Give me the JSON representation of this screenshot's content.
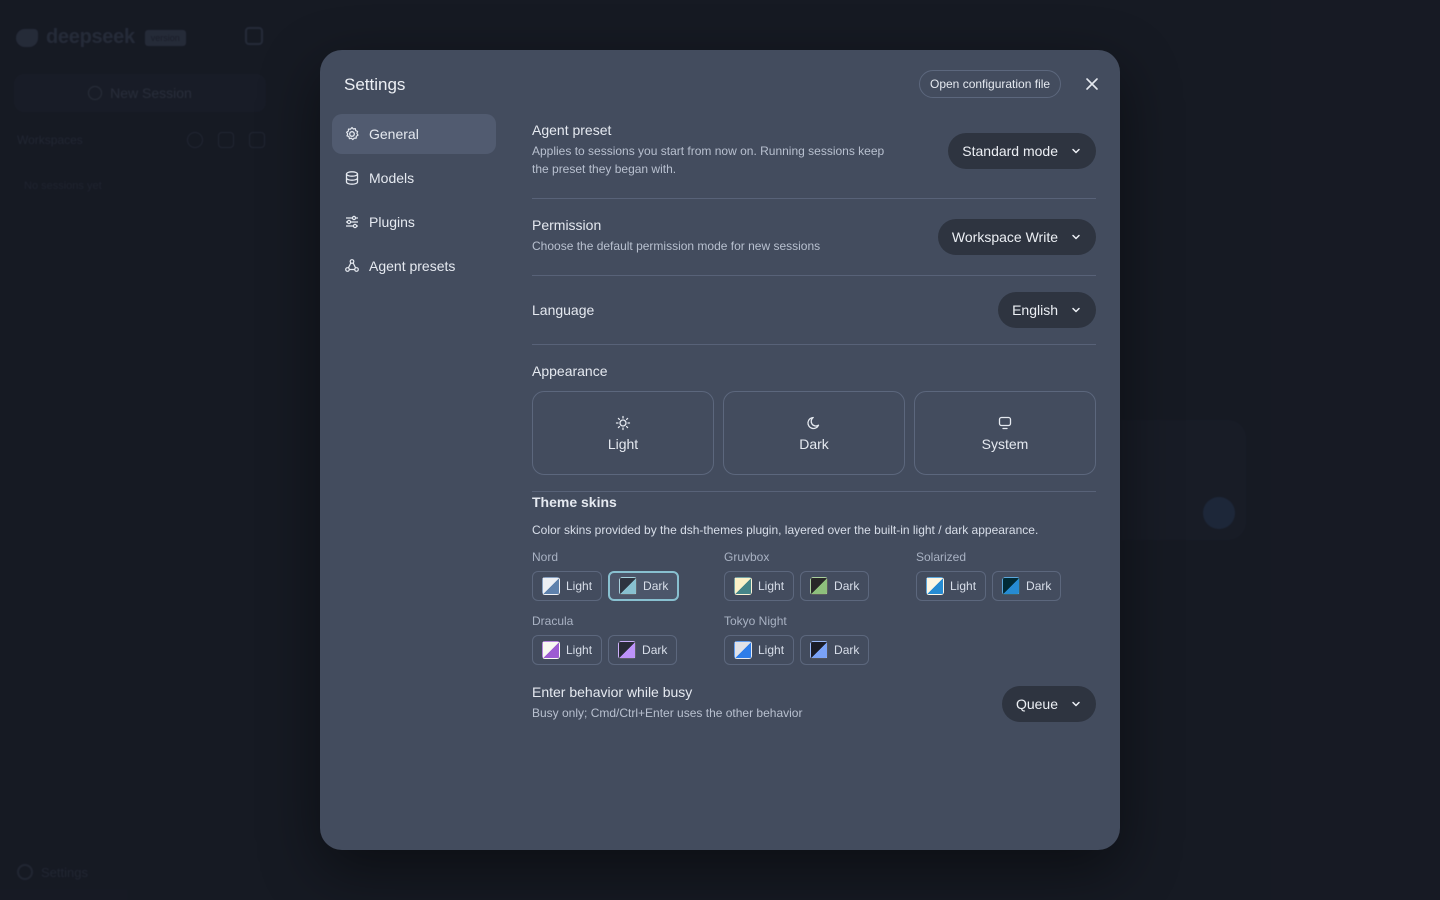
{
  "background_app": {
    "brand": "deepseek",
    "brand_badge": "version",
    "new_session_label": "New Session",
    "workspaces_label": "Workspaces",
    "empty_label": "No sessions yet",
    "settings_label": "Settings"
  },
  "modal": {
    "title": "Settings",
    "open_config_label": "Open configuration file",
    "nav": [
      {
        "label": "General",
        "icon": "gear-icon",
        "active": true
      },
      {
        "label": "Models",
        "icon": "database-icon",
        "active": false
      },
      {
        "label": "Plugins",
        "icon": "sliders-icon",
        "active": false
      },
      {
        "label": "Agent presets",
        "icon": "agent-icon",
        "active": false
      }
    ],
    "agent_preset": {
      "title": "Agent preset",
      "description": "Applies to sessions you start from now on. Running sessions keep the preset they began with.",
      "value": "Standard mode"
    },
    "permission": {
      "title": "Permission",
      "description": "Choose the default permission mode for new sessions",
      "value": "Workspace Write"
    },
    "language": {
      "title": "Language",
      "value": "English"
    },
    "appearance": {
      "title": "Appearance",
      "options": [
        {
          "label": "Light",
          "icon": "sun-icon"
        },
        {
          "label": "Dark",
          "icon": "moon-icon"
        },
        {
          "label": "System",
          "icon": "monitor-icon"
        }
      ]
    },
    "theme_skins": {
      "title": "Theme skins",
      "description": "Color skins provided by the dsh-themes plugin, layered over the built-in light / dark appearance.",
      "light_label": "Light",
      "dark_label": "Dark",
      "groups": [
        {
          "name": "Nord",
          "selected": "Dark",
          "light_colors": [
            "#eceff4",
            "#5e81ac"
          ],
          "dark_colors": [
            "#2e3440",
            "#88c0d0"
          ]
        },
        {
          "name": "Gruvbox",
          "selected": "",
          "light_colors": [
            "#fbf1c7",
            "#458588"
          ],
          "dark_colors": [
            "#282828",
            "#8ec07c"
          ]
        },
        {
          "name": "Solarized",
          "selected": "",
          "light_colors": [
            "#fdf6e3",
            "#268bd2"
          ],
          "dark_colors": [
            "#002b36",
            "#268bd2"
          ]
        },
        {
          "name": "Dracula",
          "selected": "",
          "light_colors": [
            "#f8f8f2",
            "#9d5bd2"
          ],
          "dark_colors": [
            "#282a36",
            "#bd93f9"
          ]
        },
        {
          "name": "Tokyo Night",
          "selected": "",
          "light_colors": [
            "#e1e2e7",
            "#2e7de9"
          ],
          "dark_colors": [
            "#1a1b26",
            "#7aa2f7"
          ]
        }
      ]
    },
    "enter_behavior": {
      "title": "Enter behavior while busy",
      "description": "Busy only; Cmd/Ctrl+Enter uses the other behavior",
      "value": "Queue"
    }
  }
}
